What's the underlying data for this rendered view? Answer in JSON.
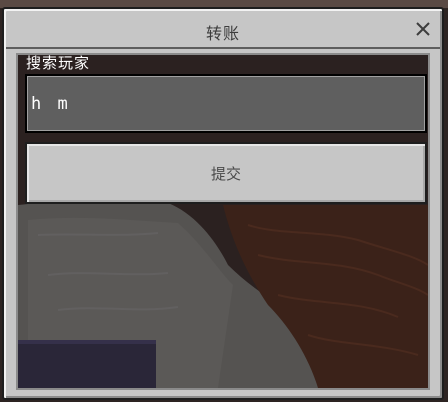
{
  "dialog": {
    "title": "转账",
    "close_icon": "close-icon"
  },
  "search": {
    "label": "搜索玩家",
    "value": "h m",
    "placeholder": ""
  },
  "submit": {
    "label": "提交"
  }
}
